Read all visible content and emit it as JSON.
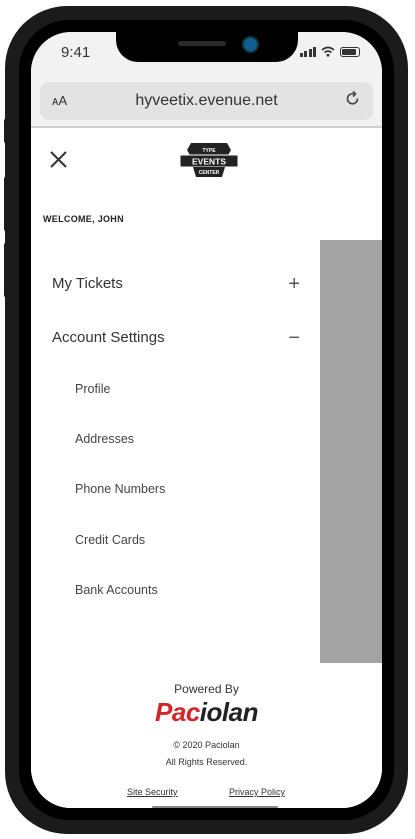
{
  "status_bar": {
    "time": "9:41"
  },
  "browser": {
    "text_size_label": "ᴀA",
    "url": "hyveetix.evenue.net"
  },
  "header": {
    "logo_lines": [
      "TYPE",
      "EVENTS",
      "CENTER"
    ]
  },
  "menu": {
    "welcome": "WELCOME, JOHN",
    "items": [
      {
        "label": "My Tickets",
        "toggle": "+"
      },
      {
        "label": "Account Settings",
        "toggle": "−"
      }
    ],
    "sub_items": [
      "Profile",
      "Addresses",
      "Phone Numbers",
      "Credit Cards",
      "Bank Accounts"
    ]
  },
  "footer": {
    "powered_by": "Powered By",
    "brand_part1": "Pac",
    "brand_part2": "iolan",
    "copyright": "© 2020 Paciolan",
    "rights": "All Rights Reserved.",
    "links": [
      "Site Security",
      "Privacy Policy"
    ]
  },
  "colors": {
    "brand_red": "#d0262c",
    "overlay_gray": "#a3a3a3"
  }
}
